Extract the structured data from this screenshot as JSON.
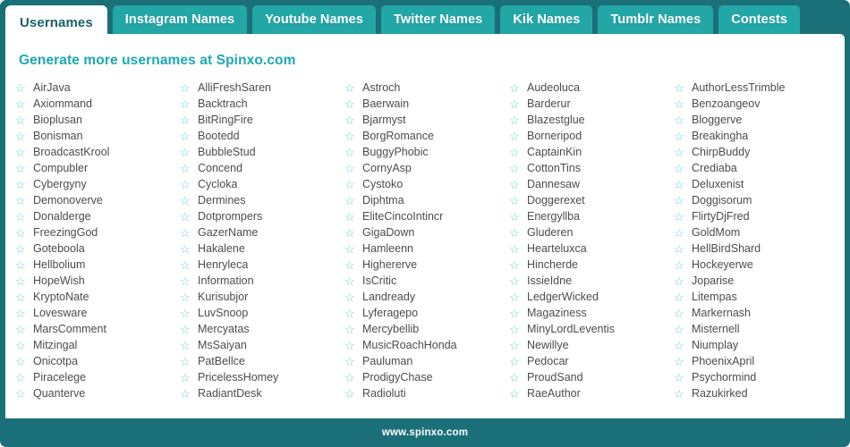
{
  "tabs": [
    {
      "label": "Usernames",
      "active": true
    },
    {
      "label": "Instagram Names",
      "active": false
    },
    {
      "label": "Youtube Names",
      "active": false
    },
    {
      "label": "Twitter Names",
      "active": false
    },
    {
      "label": "Kik Names",
      "active": false
    },
    {
      "label": "Tumblr Names",
      "active": false
    },
    {
      "label": "Contests",
      "active": false
    }
  ],
  "headline": "Generate more usernames at Spinxo.com",
  "star_icon": "☆",
  "colors": {
    "frame_dark_teal": "#1b6f78",
    "tab_teal": "#23a6a6",
    "headline_teal": "#1ba8b5",
    "star_teal": "#5fd0d8",
    "name_text": "#4c4c4c",
    "active_tab_text": "#19626b"
  },
  "columns": [
    {
      "names": [
        "AirJava",
        "Axiommand",
        "Bioplusan",
        "Bonisman",
        "BroadcastKrool",
        "Compubler",
        "Cybergyny",
        "Demonoverve",
        "Donalderge",
        "FreezingGod",
        "Goteboola",
        "Hellbolium",
        "HopeWish",
        "KryptoNate",
        "Lovesware",
        "MarsComment",
        "Mitzingal",
        "Onicotpa",
        "Piracelege",
        "Quanterve"
      ]
    },
    {
      "names": [
        "AlliFreshSaren",
        "Backtrach",
        "BitRingFire",
        "Bootedd",
        "BubbleStud",
        "Concend",
        "Cycloka",
        "Dermines",
        "Dotprompers",
        "GazerName",
        "Hakalene",
        "Henryleca",
        "Information",
        "Kurisubjor",
        "LuvSnoop",
        "Mercyatas",
        "MsSaiyan",
        "PatBellce",
        "PricelessHomey",
        "RadiantDesk"
      ]
    },
    {
      "names": [
        "Astroch",
        "Baerwain",
        "Bjarmyst",
        "BorgRomance",
        "BuggyPhobic",
        "CornyAsp",
        "Cystoko",
        "Diphtma",
        "EliteCincoIntincr",
        "GigaDown",
        "Hamleenn",
        "Highererve",
        "IsCritic",
        "Landready",
        "Lyferagepo",
        "Mercybellib",
        "MusicRoachHonda",
        "Pauluman",
        "ProdigyChase",
        "Radioluti"
      ]
    },
    {
      "names": [
        "Audeoluca",
        "Barderur",
        "Blazestglue",
        "Borneripod",
        "CaptainKin",
        "CottonTins",
        "Dannesaw",
        "Doggerexet",
        "Energyllba",
        "Gluderen",
        "Hearteluxca",
        "Hincherde",
        "IssieIdne",
        "LedgerWicked",
        "Magaziness",
        "MinyLordLeventis",
        "Newillye",
        "Pedocar",
        "ProudSand",
        "RaeAuthor"
      ]
    },
    {
      "names": [
        "AuthorLessTrimble",
        "Benzoangeov",
        "Bloggerve",
        "Breakingha",
        "ChirpBuddy",
        "Crediaba",
        "Deluxenist",
        "Doggisorum",
        "FlirtyDjFred",
        "GoldMom",
        "HellBirdShard",
        "Hockeyerwe",
        "Joparise",
        "Litempas",
        "Markernash",
        "Misternell",
        "Niumplay",
        "PhoenixApril",
        "Psychormind",
        "Razukirked"
      ]
    }
  ],
  "footer": {
    "link": "www.spinxo.com"
  }
}
